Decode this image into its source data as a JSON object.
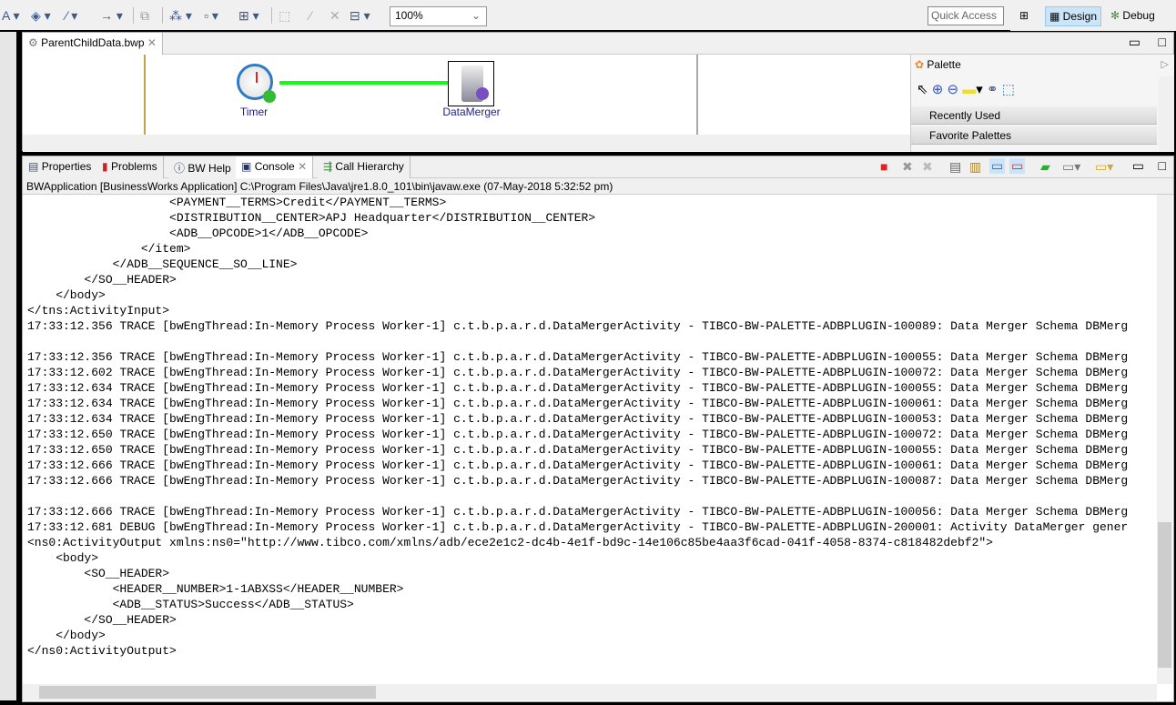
{
  "toolbar": {
    "zoom_value": "100%",
    "quick_access_placeholder": "Quick Access",
    "design_label": "Design",
    "debug_label": "Debug"
  },
  "editor": {
    "tab_label": "ParentChildData.bwp",
    "nodes": [
      {
        "label": "Timer"
      },
      {
        "label": "DataMerger"
      }
    ]
  },
  "palette": {
    "title": "Palette",
    "drawers": [
      "Recently Used",
      "Favorite Palettes"
    ]
  },
  "bottom": {
    "tabs": [
      "Properties",
      "Problems",
      "BW Help",
      "Console",
      "Call Hierarchy"
    ],
    "process_line": "BWApplication [BusinessWorks Application] C:\\Program Files\\Java\\jre1.8.0_101\\bin\\javaw.exe (07-May-2018 5:32:52 pm)",
    "console_lines": [
      "                    <PAYMENT__TERMS>Credit</PAYMENT__TERMS>",
      "                    <DISTRIBUTION__CENTER>APJ Headquarter</DISTRIBUTION__CENTER>",
      "                    <ADB__OPCODE>1</ADB__OPCODE>",
      "                </item>",
      "            </ADB__SEQUENCE__SO__LINE>",
      "        </SO__HEADER>",
      "    </body>",
      "</tns:ActivityInput>",
      "17:33:12.356 TRACE [bwEngThread:In-Memory Process Worker-1] c.t.b.p.a.r.d.DataMergerActivity - TIBCO-BW-PALETTE-ADBPLUGIN-100089: Data Merger Schema DBMerg",
      "",
      "17:33:12.356 TRACE [bwEngThread:In-Memory Process Worker-1] c.t.b.p.a.r.d.DataMergerActivity - TIBCO-BW-PALETTE-ADBPLUGIN-100055: Data Merger Schema DBMerg",
      "17:33:12.602 TRACE [bwEngThread:In-Memory Process Worker-1] c.t.b.p.a.r.d.DataMergerActivity - TIBCO-BW-PALETTE-ADBPLUGIN-100072: Data Merger Schema DBMerg",
      "17:33:12.634 TRACE [bwEngThread:In-Memory Process Worker-1] c.t.b.p.a.r.d.DataMergerActivity - TIBCO-BW-PALETTE-ADBPLUGIN-100055: Data Merger Schema DBMerg",
      "17:33:12.634 TRACE [bwEngThread:In-Memory Process Worker-1] c.t.b.p.a.r.d.DataMergerActivity - TIBCO-BW-PALETTE-ADBPLUGIN-100061: Data Merger Schema DBMerg",
      "17:33:12.634 TRACE [bwEngThread:In-Memory Process Worker-1] c.t.b.p.a.r.d.DataMergerActivity - TIBCO-BW-PALETTE-ADBPLUGIN-100053: Data Merger Schema DBMerg",
      "17:33:12.650 TRACE [bwEngThread:In-Memory Process Worker-1] c.t.b.p.a.r.d.DataMergerActivity - TIBCO-BW-PALETTE-ADBPLUGIN-100072: Data Merger Schema DBMerg",
      "17:33:12.650 TRACE [bwEngThread:In-Memory Process Worker-1] c.t.b.p.a.r.d.DataMergerActivity - TIBCO-BW-PALETTE-ADBPLUGIN-100055: Data Merger Schema DBMerg",
      "17:33:12.666 TRACE [bwEngThread:In-Memory Process Worker-1] c.t.b.p.a.r.d.DataMergerActivity - TIBCO-BW-PALETTE-ADBPLUGIN-100061: Data Merger Schema DBMerg",
      "17:33:12.666 TRACE [bwEngThread:In-Memory Process Worker-1] c.t.b.p.a.r.d.DataMergerActivity - TIBCO-BW-PALETTE-ADBPLUGIN-100087: Data Merger Schema DBMerg",
      "",
      "17:33:12.666 TRACE [bwEngThread:In-Memory Process Worker-1] c.t.b.p.a.r.d.DataMergerActivity - TIBCO-BW-PALETTE-ADBPLUGIN-100056: Data Merger Schema DBMerg",
      "17:33:12.681 DEBUG [bwEngThread:In-Memory Process Worker-1] c.t.b.p.a.r.d.DataMergerActivity - TIBCO-BW-PALETTE-ADBPLUGIN-200001: Activity DataMerger gener",
      "<ns0:ActivityOutput xmlns:ns0=\"http://www.tibco.com/xmlns/adb/ece2e1c2-dc4b-4e1f-bd9c-14e106c85be4aa3f6cad-041f-4058-8374-c818482debf2\">",
      "    <body>",
      "        <SO__HEADER>",
      "            <HEADER__NUMBER>1-1ABXSS</HEADER__NUMBER>",
      "            <ADB__STATUS>Success</ADB__STATUS>",
      "        </SO__HEADER>",
      "    </body>",
      "</ns0:ActivityOutput>"
    ]
  }
}
